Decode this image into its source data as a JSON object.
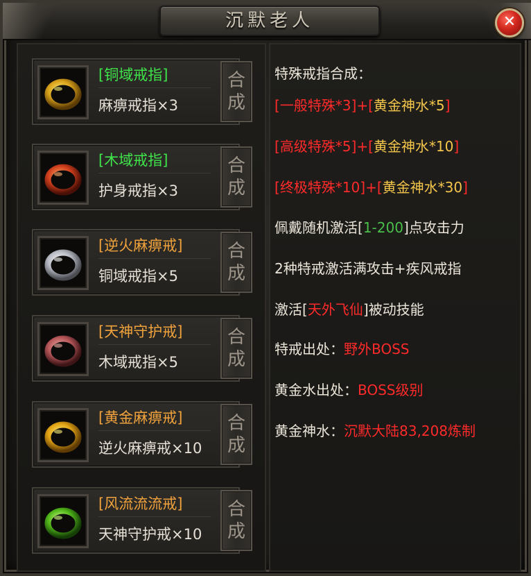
{
  "window": {
    "title": "沉默老人",
    "close_label": "✕"
  },
  "rings": [
    {
      "name": "[铜域戒指]",
      "name_color": "#3fe34a",
      "requirement": "麻痹戒指×3",
      "icon": "gold-chain-ring-icon",
      "combine_top": "合",
      "combine_bottom": "成"
    },
    {
      "name": "[木域戒指]",
      "name_color": "#3fe34a",
      "requirement": "护身戒指×3",
      "icon": "fire-ring-icon",
      "combine_top": "合",
      "combine_bottom": "成"
    },
    {
      "name": "[逆火麻痹戒]",
      "name_color": "#f0a23c",
      "requirement": "铜域戒指×5",
      "icon": "silver-ring-icon",
      "combine_top": "合",
      "combine_bottom": "成"
    },
    {
      "name": "[天神守护戒]",
      "name_color": "#f0a23c",
      "requirement": "木域戒指×5",
      "icon": "rose-ring-icon",
      "combine_top": "合",
      "combine_bottom": "成"
    },
    {
      "name": "[黄金麻痹戒]",
      "name_color": "#f0a23c",
      "requirement": "逆火麻痹戒×10",
      "icon": "golden-ring-icon",
      "combine_top": "合",
      "combine_bottom": "成"
    },
    {
      "name": "[风流流流戒]",
      "name_color": "#f0a23c",
      "requirement": "天神守护戒×10",
      "icon": "green-ring-icon",
      "combine_top": "合",
      "combine_bottom": "成"
    }
  ],
  "info": {
    "heading": "特殊戒指合成：",
    "recipe1": {
      "open": "[",
      "item": "一般特殊*3",
      "mid": "]+[",
      "reagent": "黄金神水*5",
      "close": "]"
    },
    "recipe2": {
      "open": "[",
      "item": "高级特殊*5",
      "mid": "]+[",
      "reagent": "黄金神水*10",
      "close": "]"
    },
    "recipe3": {
      "open": "[",
      "item": "终极特殊*10",
      "mid": "]+[",
      "reagent": "黄金神水*30",
      "close": "]"
    },
    "line4": {
      "pre": "佩戴随机激活[",
      "range": "1-200",
      "post": "]点攻击力"
    },
    "line5": "2种特戒激活满攻击+疾风戒指",
    "line6": {
      "pre": "激活[",
      "skill": "天外飞仙",
      "post": "]被动技能"
    },
    "line7": {
      "label": "特戒出处：",
      "value": "野外BOSS"
    },
    "line8": {
      "label": "黄金水出处：",
      "value": "BOSS级别"
    },
    "line9": {
      "label": "黄金神水：",
      "value": "沉默大陆83,208炼制"
    }
  },
  "colors": {
    "accent_red": "#ff2a2a",
    "accent_gold": "#f3c54a",
    "accent_green": "#48c04a",
    "name_green": "#3fe34a",
    "name_orange": "#f0a23c"
  }
}
